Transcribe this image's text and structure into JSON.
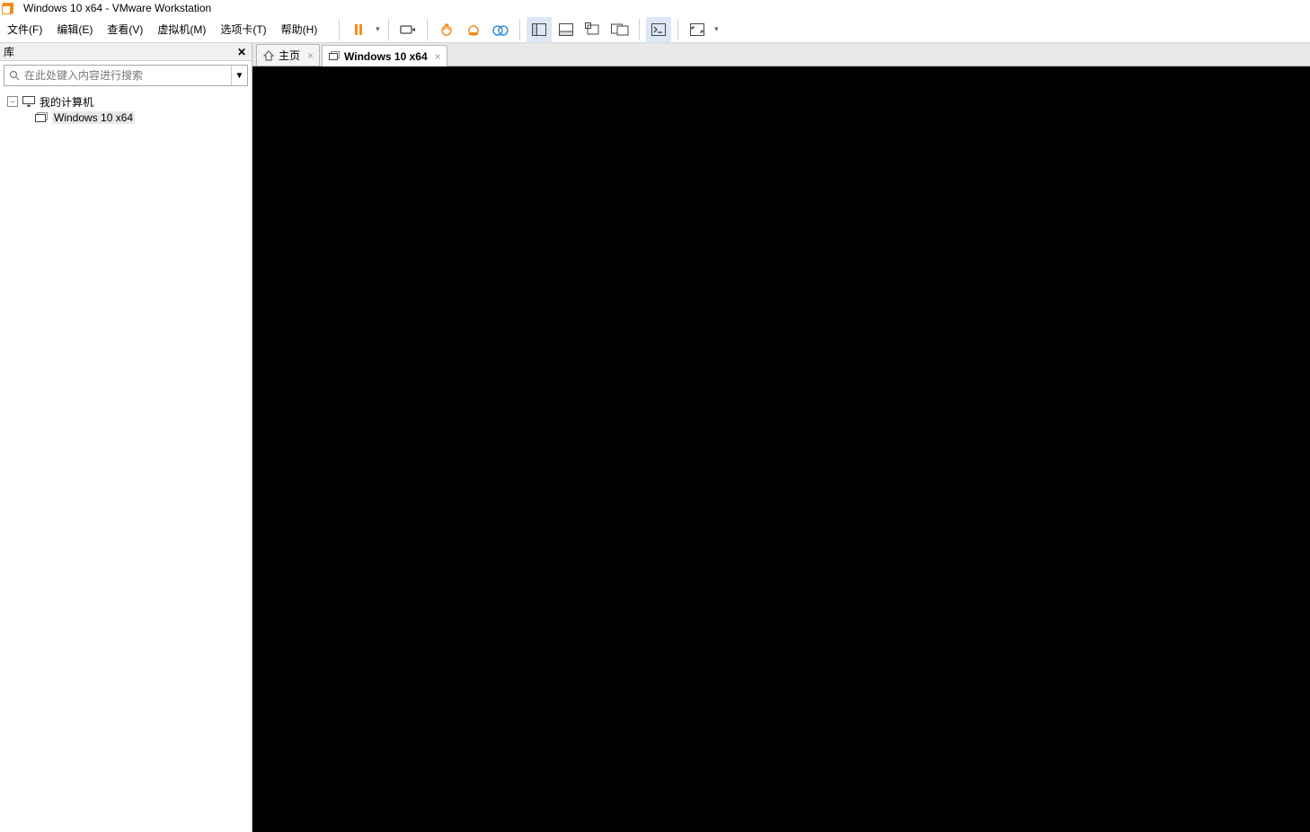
{
  "titlebar": {
    "title": "Windows 10 x64 - VMware Workstation"
  },
  "menu": {
    "file": "文件(F)",
    "edit": "编辑(E)",
    "view": "查看(V)",
    "vm": "虚拟机(M)",
    "tabs": "选项卡(T)",
    "help": "帮助(H)"
  },
  "sidebar": {
    "title": "库",
    "search_placeholder": "在此处键入内容进行搜索",
    "root": "我的计算机",
    "child": "Windows 10 x64"
  },
  "tabs": {
    "home": "主页",
    "vm": "Windows 10 x64"
  },
  "colors": {
    "accent": "#f28c1c",
    "snapshot": "#3a8fd6"
  }
}
